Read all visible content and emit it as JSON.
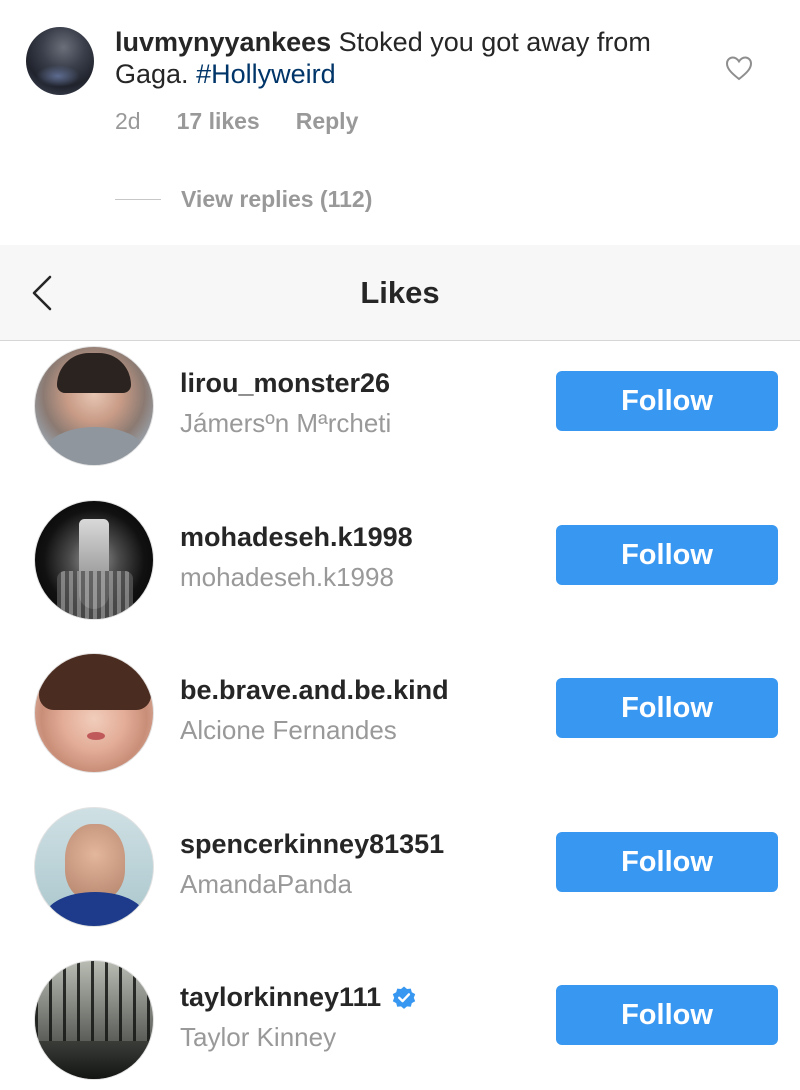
{
  "comment": {
    "username": "luvmynyyankees",
    "text": "Stoked you got away from Gaga.",
    "hashtag": "#Hollyweird",
    "time": "2d",
    "likes": "17 likes",
    "reply_label": "Reply",
    "view_replies": "View replies (112)"
  },
  "header": {
    "title": "Likes"
  },
  "likes": [
    {
      "username": "lirou_monster26",
      "name": "Jámersºn  Mªrcheti",
      "button": "Follow",
      "verified": false
    },
    {
      "username": "mohadeseh.k1998",
      "name": "mohadeseh.k1998",
      "button": "Follow",
      "verified": false
    },
    {
      "username": "be.brave.and.be.kind",
      "name": "Alcione Fernandes",
      "button": "Follow",
      "verified": false
    },
    {
      "username": "spencerkinney81351",
      "name": "AmandaPanda",
      "button": "Follow",
      "verified": false
    },
    {
      "username": "taylorkinney111",
      "name": "Taylor Kinney",
      "button": "Follow",
      "verified": true
    }
  ],
  "colors": {
    "follow_button": "#3897f0",
    "verified_badge": "#3897f0",
    "hashtag": "#003569",
    "secondary_text": "#999999"
  },
  "icons": {
    "heart": "heart-outline-icon",
    "back": "chevron-left-icon",
    "verified": "verified-badge-icon"
  }
}
